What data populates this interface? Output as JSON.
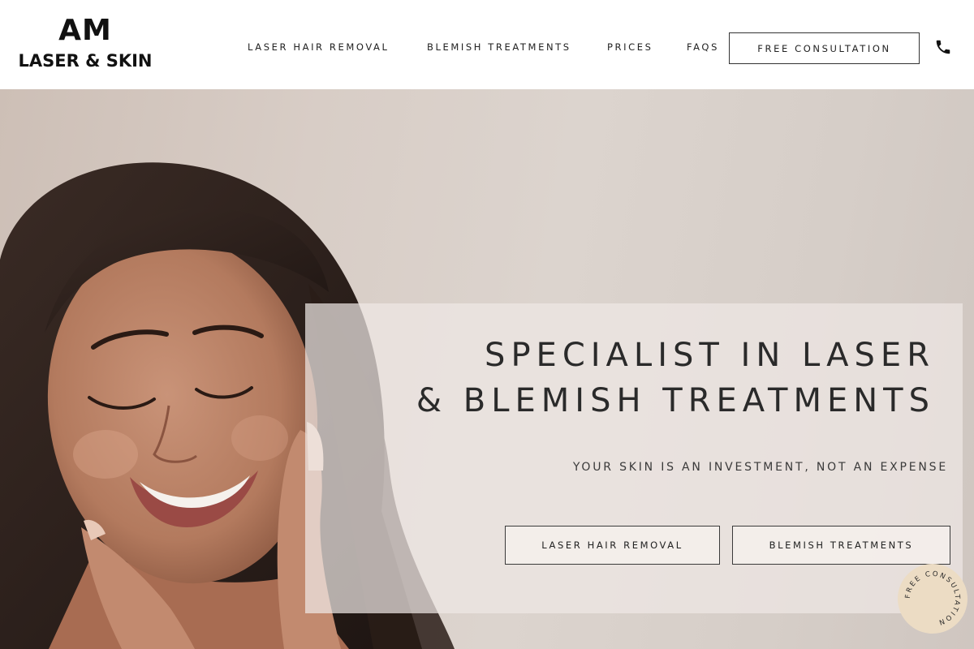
{
  "logo": {
    "line1": "AM",
    "line2": "LASER & SKIN"
  },
  "nav": {
    "items": [
      {
        "label": "LASER HAIR REMOVAL"
      },
      {
        "label": "BLEMISH TREATMENTS"
      },
      {
        "label": "PRICES"
      },
      {
        "label": "FAQS"
      }
    ],
    "cta_label": "FREE CONSULTATION",
    "phone_icon": "phone-icon"
  },
  "hero": {
    "title_line1": "SPECIALIST IN LASER",
    "title_line2": "& BLEMISH TREATMENTS",
    "tagline": "YOUR SKIN IS AN INVESTMENT, NOT AN EXPENSE",
    "buttons": [
      {
        "label": "LASER HAIR REMOVAL"
      },
      {
        "label": "BLEMISH TREATMENTS"
      }
    ],
    "badge_text": "FREE CONSULTATION"
  },
  "colors": {
    "header_bg": "#ffffff",
    "text": "#222222",
    "overlay": "#eee8e4",
    "badge": "#ecdcc4",
    "hero_bg": "#d8cdc6"
  }
}
